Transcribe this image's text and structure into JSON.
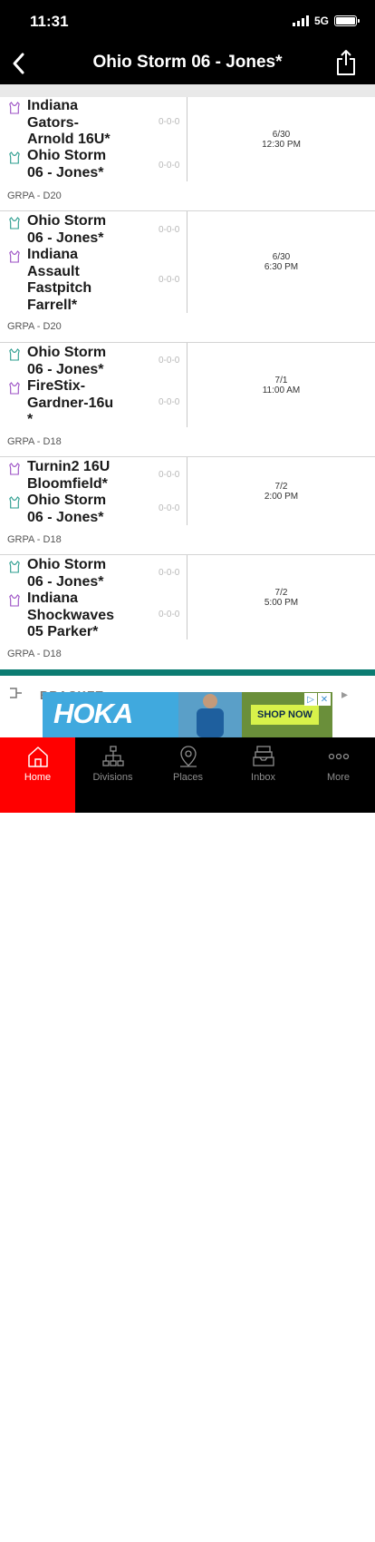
{
  "status_bar": {
    "time": "11:31",
    "network": "5G"
  },
  "header": {
    "title": "Ohio Storm 06 - Jones*"
  },
  "colors": {
    "accent": "#ff0000",
    "teal": "#0c7c72",
    "jersey_teal": "#2a9c8e",
    "jersey_purple": "#9b4fc4"
  },
  "games": [
    {
      "teams": [
        {
          "name": "Indiana Gators-Arnold 16U*",
          "icon": "jersey-purple-icon",
          "score": "0-0-0"
        },
        {
          "name": "Ohio Storm 06 - Jones*",
          "icon": "jersey-teal-icon",
          "score": "0-0-0"
        }
      ],
      "date": "6/30",
      "time": "12:30 PM",
      "division": "GRPA - D20"
    },
    {
      "teams": [
        {
          "name": "Ohio Storm 06 - Jones*",
          "icon": "jersey-teal-icon",
          "score": "0-0-0"
        },
        {
          "name": "Indiana Assault Fastpitch Farrell*",
          "icon": "jersey-purple-icon",
          "score": "0-0-0"
        }
      ],
      "date": "6/30",
      "time": "6:30 PM",
      "division": "GRPA - D20"
    },
    {
      "teams": [
        {
          "name": "Ohio Storm 06 - Jones*",
          "icon": "jersey-teal-icon",
          "score": "0-0-0"
        },
        {
          "name": "FireStix-Gardner-16u *",
          "icon": "jersey-purple-icon",
          "score": "0-0-0"
        }
      ],
      "date": "7/1",
      "time": "11:00 AM",
      "division": "GRPA - D18"
    },
    {
      "teams": [
        {
          "name": "Turnin2 16U Bloomfield*",
          "icon": "jersey-purple-icon",
          "score": "0-0-0"
        },
        {
          "name": "Ohio Storm 06 - Jones*",
          "icon": "jersey-teal-icon",
          "score": "0-0-0"
        }
      ],
      "date": "7/2",
      "time": "2:00 PM",
      "division": "GRPA - D18"
    },
    {
      "teams": [
        {
          "name": "Ohio Storm 06 - Jones*",
          "icon": "jersey-teal-icon",
          "score": "0-0-0"
        },
        {
          "name": "Indiana Shockwaves 05 Parker*",
          "icon": "jersey-purple-icon",
          "score": "0-0-0"
        }
      ],
      "date": "7/2",
      "time": "5:00 PM",
      "division": "GRPA - D18"
    }
  ],
  "bracket": {
    "label": "BRACKET"
  },
  "ad": {
    "brand": "HOKA",
    "cta": "SHOP NOW"
  },
  "tabs": [
    {
      "label": "Home",
      "icon": "home-icon",
      "active": true
    },
    {
      "label": "Divisions",
      "icon": "divisions-icon",
      "active": false
    },
    {
      "label": "Places",
      "icon": "map-pin-icon",
      "active": false
    },
    {
      "label": "Inbox",
      "icon": "inbox-icon",
      "active": false
    },
    {
      "label": "More",
      "icon": "more-icon",
      "active": false
    }
  ]
}
